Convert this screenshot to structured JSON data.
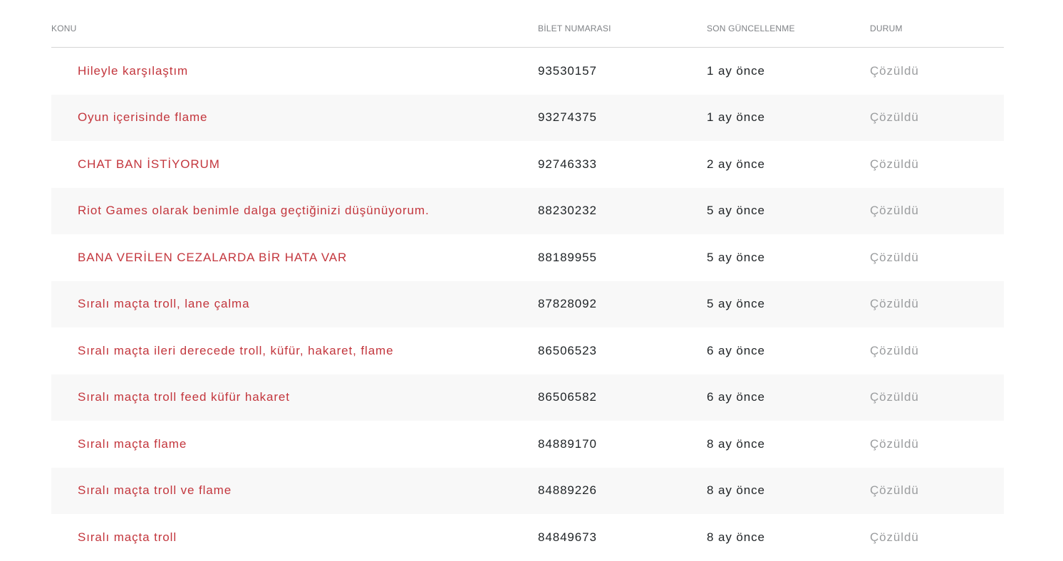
{
  "columns": {
    "subject": "KONU",
    "ticket_number": "BİLET NUMARASI",
    "last_updated": "SON GÜNCELLENME",
    "status": "DURUM"
  },
  "tickets": [
    {
      "subject": "Hileyle karşılaştım",
      "number": "93530157",
      "updated": "1 ay önce",
      "status": "Çözüldü"
    },
    {
      "subject": "Oyun içerisinde flame",
      "number": "93274375",
      "updated": "1 ay önce",
      "status": "Çözüldü"
    },
    {
      "subject": "CHAT BAN İSTİYORUM",
      "number": "92746333",
      "updated": "2 ay önce",
      "status": "Çözüldü"
    },
    {
      "subject": "Riot Games olarak benimle dalga geçtiğinizi düşünüyorum.",
      "number": "88230232",
      "updated": "5 ay önce",
      "status": "Çözüldü"
    },
    {
      "subject": "BANA VERİLEN CEZALARDA BİR HATA VAR",
      "number": "88189955",
      "updated": "5 ay önce",
      "status": "Çözüldü"
    },
    {
      "subject": "Sıralı maçta troll, lane çalma",
      "number": "87828092",
      "updated": "5 ay önce",
      "status": "Çözüldü"
    },
    {
      "subject": "Sıralı maçta ileri derecede troll, küfür, hakaret, flame",
      "number": "86506523",
      "updated": "6 ay önce",
      "status": "Çözüldü"
    },
    {
      "subject": "Sıralı maçta troll feed küfür hakaret",
      "number": "86506582",
      "updated": "6 ay önce",
      "status": "Çözüldü"
    },
    {
      "subject": "Sıralı maçta flame",
      "number": "84889170",
      "updated": "8 ay önce",
      "status": "Çözüldü"
    },
    {
      "subject": "Sıralı maçta troll ve flame",
      "number": "84889226",
      "updated": "8 ay önce",
      "status": "Çözüldü"
    },
    {
      "subject": "Sıralı maçta troll",
      "number": "84849673",
      "updated": "8 ay önce",
      "status": "Çözüldü"
    }
  ]
}
